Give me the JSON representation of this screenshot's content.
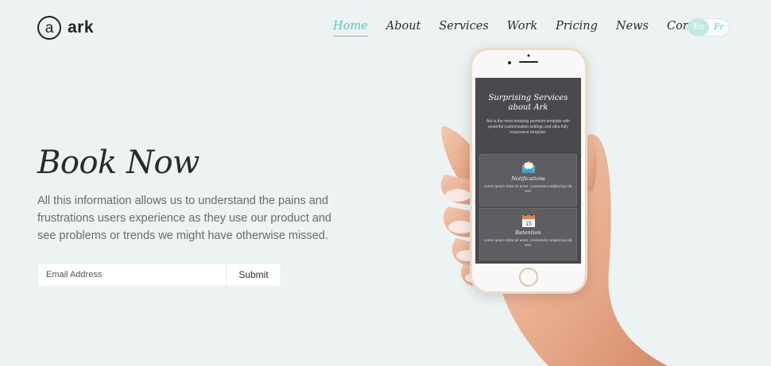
{
  "brand": {
    "mark": "a",
    "name": "ark"
  },
  "nav": {
    "items": [
      "Home",
      "About",
      "Services",
      "Work",
      "Pricing",
      "News",
      "Contacts"
    ],
    "active": "Home"
  },
  "lang": {
    "options": [
      "En",
      "Fr"
    ],
    "selected": "En"
  },
  "hero": {
    "title": "Book Now",
    "text": "All this information allows us to understand the pains and frustrations users experience as they use our product and see problems or trends we might have otherwise missed."
  },
  "form": {
    "email_placeholder": "Email Address",
    "submit_label": "Submit"
  },
  "phone": {
    "title": "Surprising Services about Ark",
    "text": "Ark is the most amazing premium template with powerful customization settings and ultra fully responsive template.",
    "cards": [
      {
        "title": "Notifications",
        "text": "Lorem ipsum dolor sit amet, consectetur adipiscing elit, sed.",
        "icon": "envelope-icon"
      },
      {
        "title": "Retention",
        "text": "Lorem ipsum dolor sit amet, consectetur adipiscing elit, sed.",
        "icon": "calendar-icon",
        "icon_text": "15"
      }
    ]
  },
  "colors": {
    "accent": "#5bc7bd",
    "background": "#edf3f3",
    "screen": "#4a4a4e"
  }
}
